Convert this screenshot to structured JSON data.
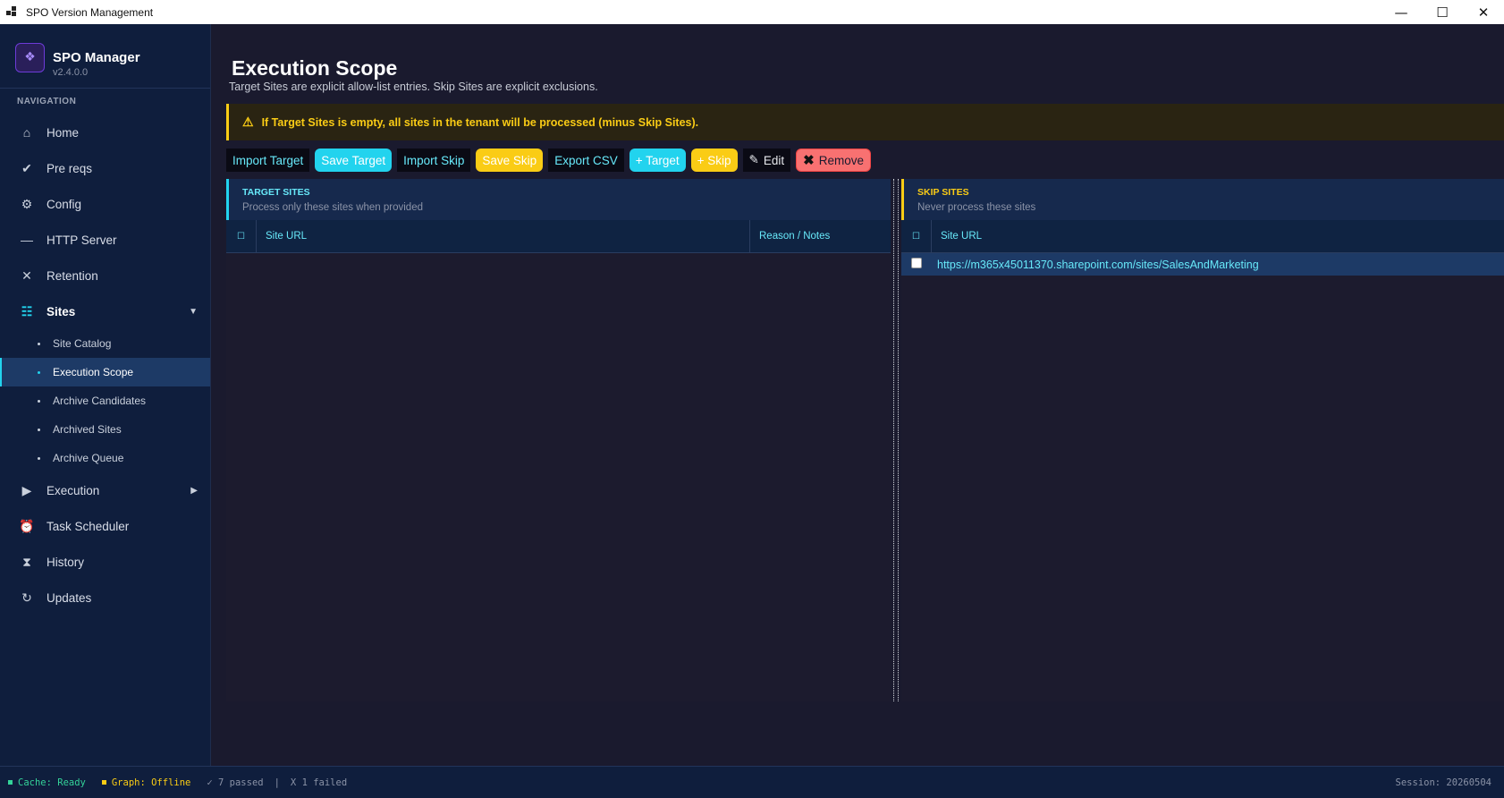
{
  "window": {
    "title": "SPO Version Management",
    "controls": {
      "minimize": "—",
      "maximize": "☐",
      "close": "✕"
    }
  },
  "brand": {
    "name": "SPO Manager",
    "version": "v2.4.0.0",
    "logo_icon": "❖"
  },
  "nav": {
    "heading": "NAVIGATION",
    "items": [
      {
        "label": "Home",
        "icon": "⌂"
      },
      {
        "label": "Pre reqs",
        "icon": "✔"
      },
      {
        "label": "Config",
        "icon": "⚙"
      },
      {
        "label": "HTTP Server",
        "icon": "—"
      },
      {
        "label": "Retention",
        "icon": "✕"
      },
      {
        "label": "Sites",
        "icon": "☷",
        "caret": "▼"
      },
      {
        "label": "Execution",
        "icon": "▶",
        "caret": "▶"
      },
      {
        "label": "Task Scheduler",
        "icon": "⏰"
      },
      {
        "label": "History",
        "icon": "⧗"
      },
      {
        "label": "Updates",
        "icon": "↻"
      }
    ],
    "sites_sub": [
      {
        "label": "Site Catalog"
      },
      {
        "label": "Execution Scope"
      },
      {
        "label": "Archive Candidates"
      },
      {
        "label": "Archived Sites"
      },
      {
        "label": "Archive Queue"
      }
    ]
  },
  "page": {
    "title": "Execution Scope",
    "subtitle": "Target Sites are explicit allow-list entries. Skip Sites are explicit exclusions.",
    "warning": "If Target Sites is empty, all sites in the tenant will be processed (minus Skip Sites).",
    "warning_icon": "⚠"
  },
  "toolbar": {
    "import_target": "Import Target",
    "save_target": "Save Target",
    "import_skip": "Import Skip",
    "save_skip": "Save Skip",
    "export_csv": "Export CSV",
    "add_target": "+ Target",
    "add_skip": "+ Skip",
    "edit": "Edit",
    "edit_icon": "✎",
    "remove": "Remove",
    "remove_icon": "✖"
  },
  "target_panel": {
    "title": "TARGET SITES",
    "description": "Process only these sites when provided",
    "columns": {
      "url": "Site URL",
      "notes": "Reason / Notes"
    },
    "rows": []
  },
  "skip_panel": {
    "title": "SKIP SITES",
    "description": "Never process these sites",
    "columns": {
      "url": "Site URL"
    },
    "rows": [
      {
        "url": "https://m365x45011370.sharepoint.com/sites/SalesAndMarketing"
      }
    ]
  },
  "status": {
    "cache": "Cache: Ready",
    "graph": "Graph: Offline",
    "passed": "✓ 7 passed",
    "separator": "|",
    "failed": "X 1 failed",
    "session": "Session: 20260504"
  },
  "colors": {
    "accent_cyan": "#22d3ee",
    "accent_yellow": "#facc15",
    "danger": "#f87171",
    "sidebar_bg": "#0f1e3d",
    "main_bg": "#1a1a2e"
  }
}
